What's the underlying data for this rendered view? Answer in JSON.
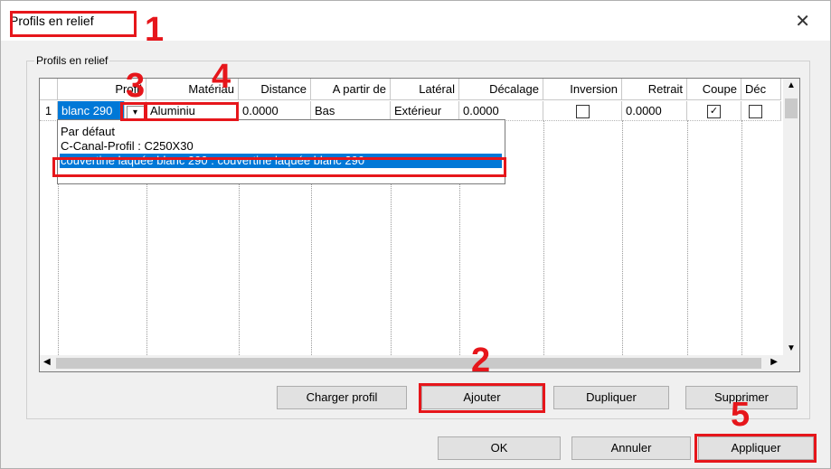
{
  "window": {
    "title": "Profils en relief",
    "close_glyph": "✕"
  },
  "group": {
    "label": "Profils en relief"
  },
  "table": {
    "columns": [
      "Profil",
      "Matériau",
      "Distance",
      "A partir de",
      "Latéral",
      "Décalage",
      "Inversion",
      "Retrait",
      "Coupe",
      "Déc"
    ],
    "row": {
      "index": "1",
      "profil": "blanc 290",
      "materiau": "Aluminiu",
      "distance": "0.0000",
      "a_partir_de": "Bas",
      "lateral": "Extérieur",
      "decalage": "0.0000",
      "inversion": false,
      "retrait": "0.0000",
      "coupe": true,
      "dec": false
    }
  },
  "dropdown": {
    "options": [
      "Par défaut",
      "C-Canal-Profil : C250X30",
      "couvertine laquée blanc 290 : couvertine laquée blanc 290"
    ],
    "selected_index": 2
  },
  "buttons": {
    "charger_profil": "Charger profil",
    "ajouter": "Ajouter",
    "dupliquer": "Dupliquer",
    "supprimer": "Supprimer",
    "ok": "OK",
    "annuler": "Annuler",
    "appliquer": "Appliquer"
  },
  "annotations": [
    "1",
    "2",
    "3",
    "4",
    "5"
  ],
  "colors": {
    "annotation": "#e6161b",
    "selection": "#0078d7"
  }
}
